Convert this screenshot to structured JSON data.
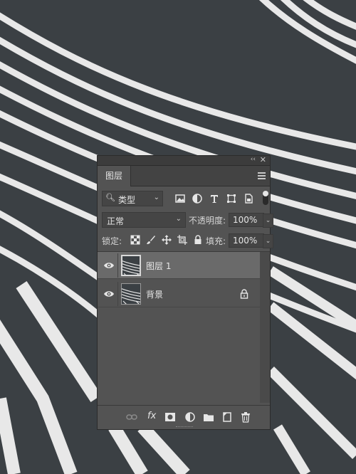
{
  "panel": {
    "title_controls": {
      "collapse": "‹‹",
      "close": "✕"
    },
    "tab_label": "图层",
    "filter": {
      "kind_label": "类型",
      "icons": [
        "image-filter-icon",
        "adjustment-filter-icon",
        "type-filter-icon",
        "shape-filter-icon",
        "smart-object-filter-icon"
      ]
    },
    "blend_mode": "正常",
    "opacity_label": "不透明度:",
    "opacity_value": "100%",
    "lock_label": "锁定:",
    "lock_icons": [
      "lock-transparent-pixels-icon",
      "lock-image-pixels-icon",
      "lock-position-icon",
      "lock-artboard-icon",
      "lock-all-icon"
    ],
    "fill_label": "填充:",
    "fill_value": "100%",
    "layers": [
      {
        "name": "图层 1",
        "visible": true,
        "selected": true,
        "locked": false
      },
      {
        "name": "背景",
        "visible": true,
        "selected": false,
        "locked": true
      }
    ],
    "bottom_icons": [
      "link-layers-icon",
      "fx-icon",
      "add-mask-icon",
      "adjustment-layer-icon",
      "new-group-icon",
      "new-layer-icon",
      "delete-icon"
    ],
    "fx_label": "fx"
  },
  "colors": {
    "panel_bg": "#535353",
    "selected_row": "#6a6a6a",
    "asphalt": "#3b4044",
    "stripe": "#e8e8e8"
  }
}
